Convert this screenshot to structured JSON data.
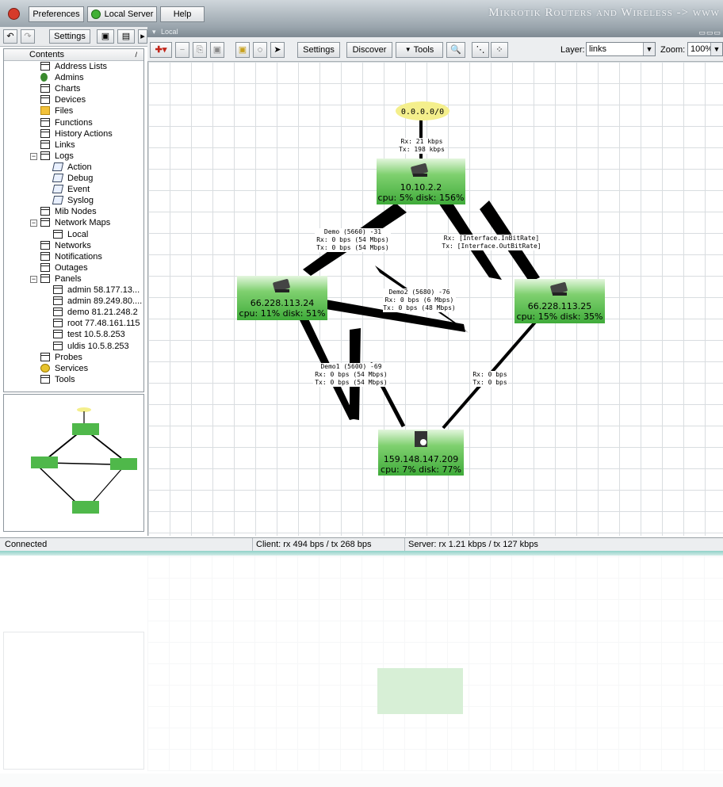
{
  "toolbar": {
    "preferences": "Preferences",
    "local_server": "Local Server",
    "help": "Help",
    "brand": "Mikrotik Routers and Wireless -> www",
    "settings": "Settings"
  },
  "tree": {
    "header": "Contents",
    "items": [
      {
        "label": "Address Lists",
        "icon": "doc-icon",
        "level": 2
      },
      {
        "label": "Admins",
        "icon": "admin-icon",
        "level": 2
      },
      {
        "label": "Charts",
        "icon": "doc-icon",
        "level": 2
      },
      {
        "label": "Devices",
        "icon": "doc-icon",
        "level": 2
      },
      {
        "label": "Files",
        "icon": "files-icon",
        "level": 2
      },
      {
        "label": "Functions",
        "icon": "doc-icon",
        "level": 2
      },
      {
        "label": "History Actions",
        "icon": "doc-icon",
        "level": 2
      },
      {
        "label": "Links",
        "icon": "doc-icon",
        "level": 2
      },
      {
        "label": "Logs",
        "icon": "doc-icon",
        "level": 2,
        "expander": "−"
      },
      {
        "label": "Action",
        "icon": "log-icon",
        "level": 3
      },
      {
        "label": "Debug",
        "icon": "log-icon",
        "level": 3
      },
      {
        "label": "Event",
        "icon": "log-icon",
        "level": 3
      },
      {
        "label": "Syslog",
        "icon": "log-icon",
        "level": 3
      },
      {
        "label": "Mib Nodes",
        "icon": "doc-icon",
        "level": 2
      },
      {
        "label": "Network Maps",
        "icon": "doc-icon",
        "level": 2,
        "expander": "−"
      },
      {
        "label": "Local",
        "icon": "doc-icon",
        "level": 3
      },
      {
        "label": "Networks",
        "icon": "doc-icon",
        "level": 2
      },
      {
        "label": "Notifications",
        "icon": "doc-icon",
        "level": 2
      },
      {
        "label": "Outages",
        "icon": "doc-icon",
        "level": 2
      },
      {
        "label": "Panels",
        "icon": "doc-icon",
        "level": 2,
        "expander": "−"
      },
      {
        "label": "admin 58.177.13...",
        "icon": "doc-icon",
        "level": 3
      },
      {
        "label": "admin 89.249.80....",
        "icon": "doc-icon",
        "level": 3
      },
      {
        "label": "demo 81.21.248.2",
        "icon": "doc-icon",
        "level": 3
      },
      {
        "label": "root 77.48.161.115",
        "icon": "doc-icon",
        "level": 3
      },
      {
        "label": "test 10.5.8.253",
        "icon": "doc-icon",
        "level": 3
      },
      {
        "label": "uldis 10.5.8.253",
        "icon": "doc-icon",
        "level": 3
      },
      {
        "label": "Probes",
        "icon": "doc-icon",
        "level": 2
      },
      {
        "label": "Services",
        "icon": "services-icon",
        "level": 2
      },
      {
        "label": "Tools",
        "icon": "doc-icon",
        "level": 2
      }
    ]
  },
  "map": {
    "tab": "Local",
    "settings": "Settings",
    "discover": "Discover",
    "tools": "Tools",
    "layer_label": "Layer:",
    "layer_value": "links",
    "zoom_label": "Zoom:",
    "zoom_value": "100%",
    "network": "0.0.0.0/0",
    "nodes": [
      {
        "ip": "10.10.2.2",
        "stats": "cpu: 5% disk: 156%"
      },
      {
        "ip": "66.228.113.24",
        "stats": "cpu: 11% disk: 51%"
      },
      {
        "ip": "66.228.113.25",
        "stats": "cpu: 15% disk: 35%"
      },
      {
        "ip": "159.148.147.209",
        "stats": "cpu: 7% disk: 77%"
      }
    ],
    "links": [
      {
        "lines": [
          "Rx: 21 kbps",
          "Tx: 198 kbps"
        ]
      },
      {
        "lines": [
          "Demo (5660) -31",
          "Rx: 0 bps (54 Mbps)",
          "Tx: 0 bps (54 Mbps)"
        ]
      },
      {
        "lines": [
          "Rx: [Interface.InBitRate]",
          "Tx: [Interface.OutBitRate]"
        ]
      },
      {
        "lines": [
          "Demo2 (5680) -76",
          "Rx: 0 bps (6 Mbps)",
          "Tx: 0 bps (48 Mbps)"
        ]
      },
      {
        "lines": [
          "Demo1 (5600) -69",
          "Rx: 0 bps (54 Mbps)",
          "Tx: 0 bps (54 Mbps)"
        ]
      },
      {
        "lines": [
          "Rx: 0 bps",
          "Tx: 0 bps"
        ]
      }
    ]
  },
  "status": {
    "connection": "Connected",
    "client": "Client: rx 494 bps / tx 268 bps",
    "server": "Server: rx 1.21 kbps / tx 127 kbps"
  },
  "colors": {
    "node_green": "#4fb84a",
    "node_light": "#e4f6de",
    "network_yellow": "#f4ef8c"
  }
}
